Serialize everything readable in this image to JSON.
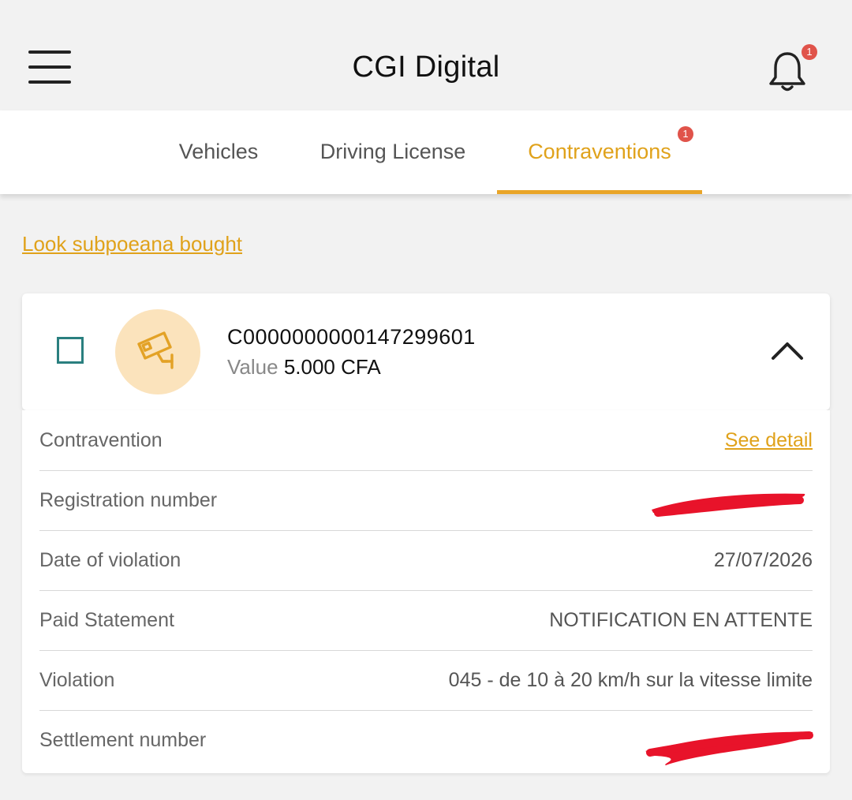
{
  "header": {
    "title": "CGI Digital",
    "notification_count": "1"
  },
  "tabs": [
    {
      "label": "Vehicles"
    },
    {
      "label": "Driving License"
    },
    {
      "label": "Contraventions",
      "badge": "1",
      "active": true
    }
  ],
  "look_link": "Look subpoeana bought",
  "ticket": {
    "id": "C0000000000147299601",
    "value_label": "Value",
    "value_amount": "5.000 CFA"
  },
  "details": [
    {
      "key": "Contravention",
      "value": "See detail"
    },
    {
      "key": "Registration number",
      "value": ""
    },
    {
      "key": "Date of violation",
      "value": "27/07/2026"
    },
    {
      "key": "Paid Statement",
      "value": "NOTIFICATION EN ATTENTE"
    },
    {
      "key": "Violation",
      "value": "045 - de 10 à 20 km/h sur la vitesse limite"
    },
    {
      "key": "Settlement number",
      "value": ""
    }
  ],
  "colors": {
    "accent": "#e9a528",
    "badge": "#e0534a",
    "checkbox": "#2a7f7f",
    "redaction": "#e8132a"
  }
}
